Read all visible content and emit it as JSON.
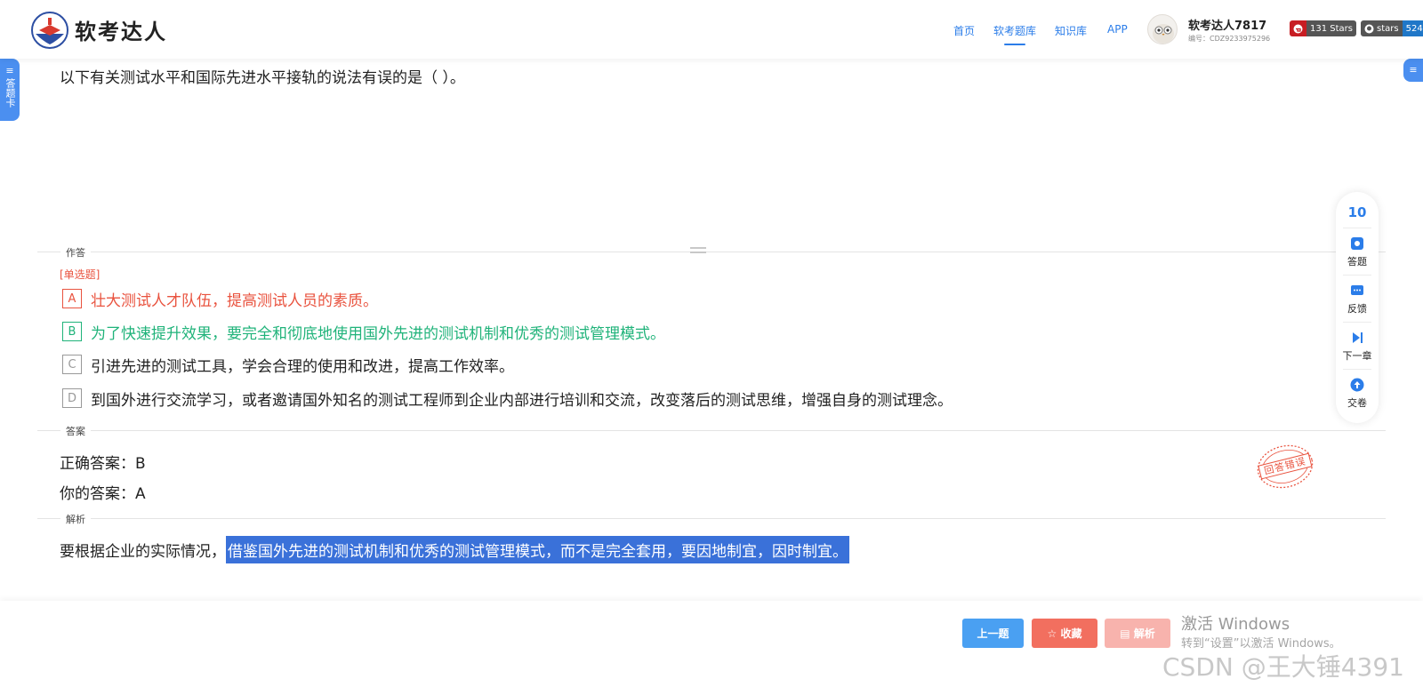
{
  "header": {
    "logo_text": "软考达人",
    "nav": [
      "首页",
      "软考题库",
      "知识库",
      "APP"
    ],
    "active_nav": "软考题库",
    "user_name": "软考达人7817",
    "user_id": "编号：CDZ9233975296",
    "badge_gitee_label": "131 Stars",
    "badge_github_left": "stars",
    "badge_github_right": "524"
  },
  "side": {
    "left_tab": "答题卡",
    "right_tab": "≡"
  },
  "question": {
    "text": "以下有关测试水平和国际先进水平接轨的说法有误的是（ ）。",
    "section_answer_label": "作答",
    "type": "[单选题]",
    "options": [
      {
        "letter": "A",
        "text": "壮大测试人才队伍，提高测试人员的素质。",
        "state": "wrong"
      },
      {
        "letter": "B",
        "text": "为了快速提升效果，要完全和彻底地使用国外先进的测试机制和优秀的测试管理模式。",
        "state": "right"
      },
      {
        "letter": "C",
        "text": "引进先进的测试工具，学会合理的使用和改进，提高工作效率。",
        "state": "normal"
      },
      {
        "letter": "D",
        "text": "到国外进行交流学习，或者邀请国外知名的测试工程师到企业内部进行培训和交流，改变落后的测试思维，增强自身的测试理念。",
        "state": "normal"
      }
    ]
  },
  "answer": {
    "section_label": "答案",
    "correct": "正确答案：B",
    "yours": "你的答案：A",
    "stamp_text": "回答错误"
  },
  "analysis": {
    "section_label": "解析",
    "text_plain": "要根据企业的实际情况，",
    "text_highlighted": "借鉴国外先进的测试机制和优秀的测试管理模式，而不是完全套用，要因地制宜，因时制宜。"
  },
  "float_panel": {
    "count": "10",
    "items": [
      "答题",
      "反馈",
      "下一章",
      "交卷"
    ]
  },
  "bottom": {
    "prev_label": "上一题",
    "fav_label": "☆ 收藏",
    "analysis_label": "▤ 解析"
  },
  "watermarks": {
    "windows_title": "激活 Windows",
    "windows_sub": "转到“设置”以激活 Windows。",
    "csdn": "CSDN @王大锤4391"
  },
  "colors": {
    "accent": "#2b7de9",
    "wrong": "#e9533f",
    "right": "#20b37a",
    "prev_button": "#4aa0f2",
    "fav_button": "#f26f5f",
    "analysis_button": "#f8b3ad",
    "highlight": "#3a71d9"
  }
}
